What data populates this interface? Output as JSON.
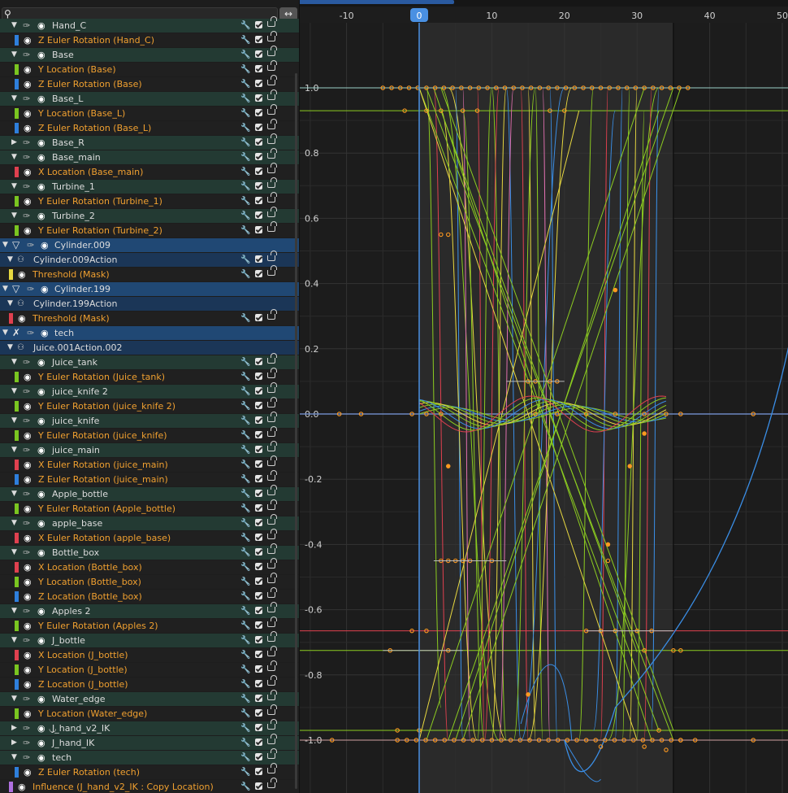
{
  "search": {
    "placeholder": "",
    "icon": "magnifier-icon",
    "swap_icon": "↔"
  },
  "channels": [
    {
      "kind": "group",
      "label": "Hand_C",
      "expanded": true
    },
    {
      "kind": "fcurve",
      "label": "Z Euler Rotation (Hand_C)",
      "color": "#2e7fdc"
    },
    {
      "kind": "group",
      "label": "Base",
      "expanded": true
    },
    {
      "kind": "fcurve",
      "label": "Y Location (Base)",
      "color": "#7ac520"
    },
    {
      "kind": "fcurve",
      "label": "Z Euler Rotation (Base)",
      "color": "#2e7fdc"
    },
    {
      "kind": "group",
      "label": "Base_L",
      "expanded": true
    },
    {
      "kind": "fcurve",
      "label": "Y Location (Base_L)",
      "color": "#7ac520"
    },
    {
      "kind": "fcurve",
      "label": "Z Euler Rotation (Base_L)",
      "color": "#2e7fdc"
    },
    {
      "kind": "group",
      "label": "Base_R",
      "expanded": false
    },
    {
      "kind": "group",
      "label": "Base_main",
      "expanded": true
    },
    {
      "kind": "fcurve",
      "label": "X Location (Base_main)",
      "color": "#e0404f"
    },
    {
      "kind": "group",
      "label": "Turbine_1",
      "expanded": true
    },
    {
      "kind": "fcurve",
      "label": "Y Euler Rotation (Turbine_1)",
      "color": "#7ac520"
    },
    {
      "kind": "group",
      "label": "Turbine_2",
      "expanded": true
    },
    {
      "kind": "fcurve",
      "label": "Y Euler Rotation (Turbine_2)",
      "color": "#7ac520"
    },
    {
      "kind": "object",
      "label": "Cylinder.009",
      "icon": "mesh-icon"
    },
    {
      "kind": "action",
      "label": "Cylinder.009Action"
    },
    {
      "kind": "fcurve2",
      "label": "Threshold (Mask)",
      "color": "#e8d840"
    },
    {
      "kind": "object",
      "label": "Cylinder.199",
      "icon": "mesh-icon"
    },
    {
      "kind": "action",
      "label": "Cylinder.199Action"
    },
    {
      "kind": "fcurve2",
      "label": "Threshold (Mask)",
      "color": "#e0404f"
    },
    {
      "kind": "object",
      "label": "tech",
      "icon": "armature-icon"
    },
    {
      "kind": "action",
      "label": "Juice.001Action.002"
    },
    {
      "kind": "group",
      "label": "Juice_tank",
      "expanded": true
    },
    {
      "kind": "fcurve",
      "label": "Y Euler Rotation (Juice_tank)",
      "color": "#7ac520"
    },
    {
      "kind": "group",
      "label": "juice_knife 2",
      "expanded": true
    },
    {
      "kind": "fcurve",
      "label": "Y Euler Rotation (juice_knife 2)",
      "color": "#7ac520"
    },
    {
      "kind": "group",
      "label": "juice_knife",
      "expanded": true
    },
    {
      "kind": "fcurve",
      "label": "Y Euler Rotation (juice_knife)",
      "color": "#7ac520"
    },
    {
      "kind": "group",
      "label": "juice_main",
      "expanded": true
    },
    {
      "kind": "fcurve",
      "label": "X Euler Rotation (juice_main)",
      "color": "#e0404f"
    },
    {
      "kind": "fcurve",
      "label": "Z Euler Rotation (juice_main)",
      "color": "#2e7fdc"
    },
    {
      "kind": "group",
      "label": "Apple_bottle",
      "expanded": true
    },
    {
      "kind": "fcurve",
      "label": "Y Euler Rotation (Apple_bottle)",
      "color": "#7ac520"
    },
    {
      "kind": "group",
      "label": "apple_base",
      "expanded": true
    },
    {
      "kind": "fcurve",
      "label": "X Euler Rotation (apple_base)",
      "color": "#e0404f"
    },
    {
      "kind": "group",
      "label": "Bottle_box",
      "expanded": true
    },
    {
      "kind": "fcurve",
      "label": "X Location (Bottle_box)",
      "color": "#e0404f"
    },
    {
      "kind": "fcurve",
      "label": "Y Location (Bottle_box)",
      "color": "#7ac520"
    },
    {
      "kind": "fcurve",
      "label": "Z Location (Bottle_box)",
      "color": "#2e7fdc"
    },
    {
      "kind": "group",
      "label": "Apples 2",
      "expanded": true
    },
    {
      "kind": "fcurve",
      "label": "Y Euler Rotation (Apples 2)",
      "color": "#7ac520"
    },
    {
      "kind": "group",
      "label": "J_bottle",
      "expanded": true
    },
    {
      "kind": "fcurve",
      "label": "X Location (J_bottle)",
      "color": "#e0404f"
    },
    {
      "kind": "fcurve",
      "label": "Y Location (J_bottle)",
      "color": "#7ac520"
    },
    {
      "kind": "fcurve",
      "label": "Z Location (J_bottle)",
      "color": "#2e7fdc"
    },
    {
      "kind": "group",
      "label": "Water_edge",
      "expanded": true
    },
    {
      "kind": "fcurve",
      "label": "Y Location (Water_edge)",
      "color": "#7ac520"
    },
    {
      "kind": "group",
      "label": "J_hand_v2_IK",
      "expanded": false,
      "constraint": true
    },
    {
      "kind": "group",
      "label": "J_hand_IK",
      "expanded": false
    },
    {
      "kind": "group",
      "label": "tech",
      "expanded": true
    },
    {
      "kind": "fcurve",
      "label": "Z Euler Rotation (tech)",
      "color": "#2e7fdc"
    },
    {
      "kind": "fcurve3",
      "label": "Influence (J_hand_v2_IK : Copy Location)",
      "color": "#b070e0"
    }
  ],
  "graph": {
    "current_frame": "0",
    "frame_ticks": [
      "-10",
      "0",
      "10",
      "20",
      "30",
      "40",
      "50"
    ],
    "value_ticks": [
      "1.0",
      "0.8",
      "0.6",
      "0.4",
      "0.2",
      "0.0",
      "-0.2",
      "-0.4",
      "-0.6",
      "-0.8",
      "-1.0"
    ],
    "colors": {
      "red": "#e0404f",
      "green": "#8ccc20",
      "blue": "#3a8ee6",
      "yellow": "#e8d840",
      "pink": "#e070b0",
      "cursor": "#4a90e2",
      "key": "#ff9a20"
    }
  }
}
